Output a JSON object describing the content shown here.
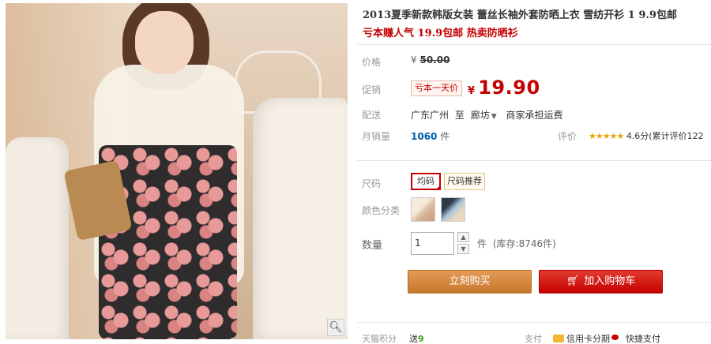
{
  "product": {
    "title": "2013夏季新款韩版女装 蕾丝长袖外套防晒上衣 雪纺开衫 1 9.9包邮",
    "subtitle": "亏本赚人气 19.9包邮 热卖防晒衫"
  },
  "price": {
    "label": "价格",
    "currency": "¥",
    "original": "50.00",
    "promo_label": "促销",
    "promo_tag": "亏本一天价",
    "current": "19.90"
  },
  "shipping": {
    "label": "配送",
    "from": "广东广州",
    "to_word": "至",
    "destination": "廊坊",
    "note": "商家承担运费"
  },
  "sales": {
    "label": "月销量",
    "count": "1060",
    "unit": "件",
    "rating_label": "评价",
    "stars": "★★★★★",
    "rating_text": "4.6分(累计评价122"
  },
  "size": {
    "label": "尺码",
    "selected": "均码",
    "recommend": "尺码推荐"
  },
  "color": {
    "label": "颜色分类"
  },
  "quantity": {
    "label": "数量",
    "value": "1",
    "unit": "件",
    "stock": "(库存:8746件)"
  },
  "buttons": {
    "buy": "立刻购买",
    "cart": "加入购物车"
  },
  "footer": {
    "points_label": "天猫积分",
    "points_prefix": "送",
    "points_value": "9",
    "pay_label": "支付",
    "credit": "信用卡分期",
    "quick": "快捷支付"
  },
  "icons": {
    "zoom": "magnifier-icon",
    "cart": "cart-icon",
    "mobile": "mobile-icon"
  },
  "colors": {
    "accent_red": "#c40000",
    "buy_orange": "#c8782f",
    "link_blue": "#005ea7"
  }
}
